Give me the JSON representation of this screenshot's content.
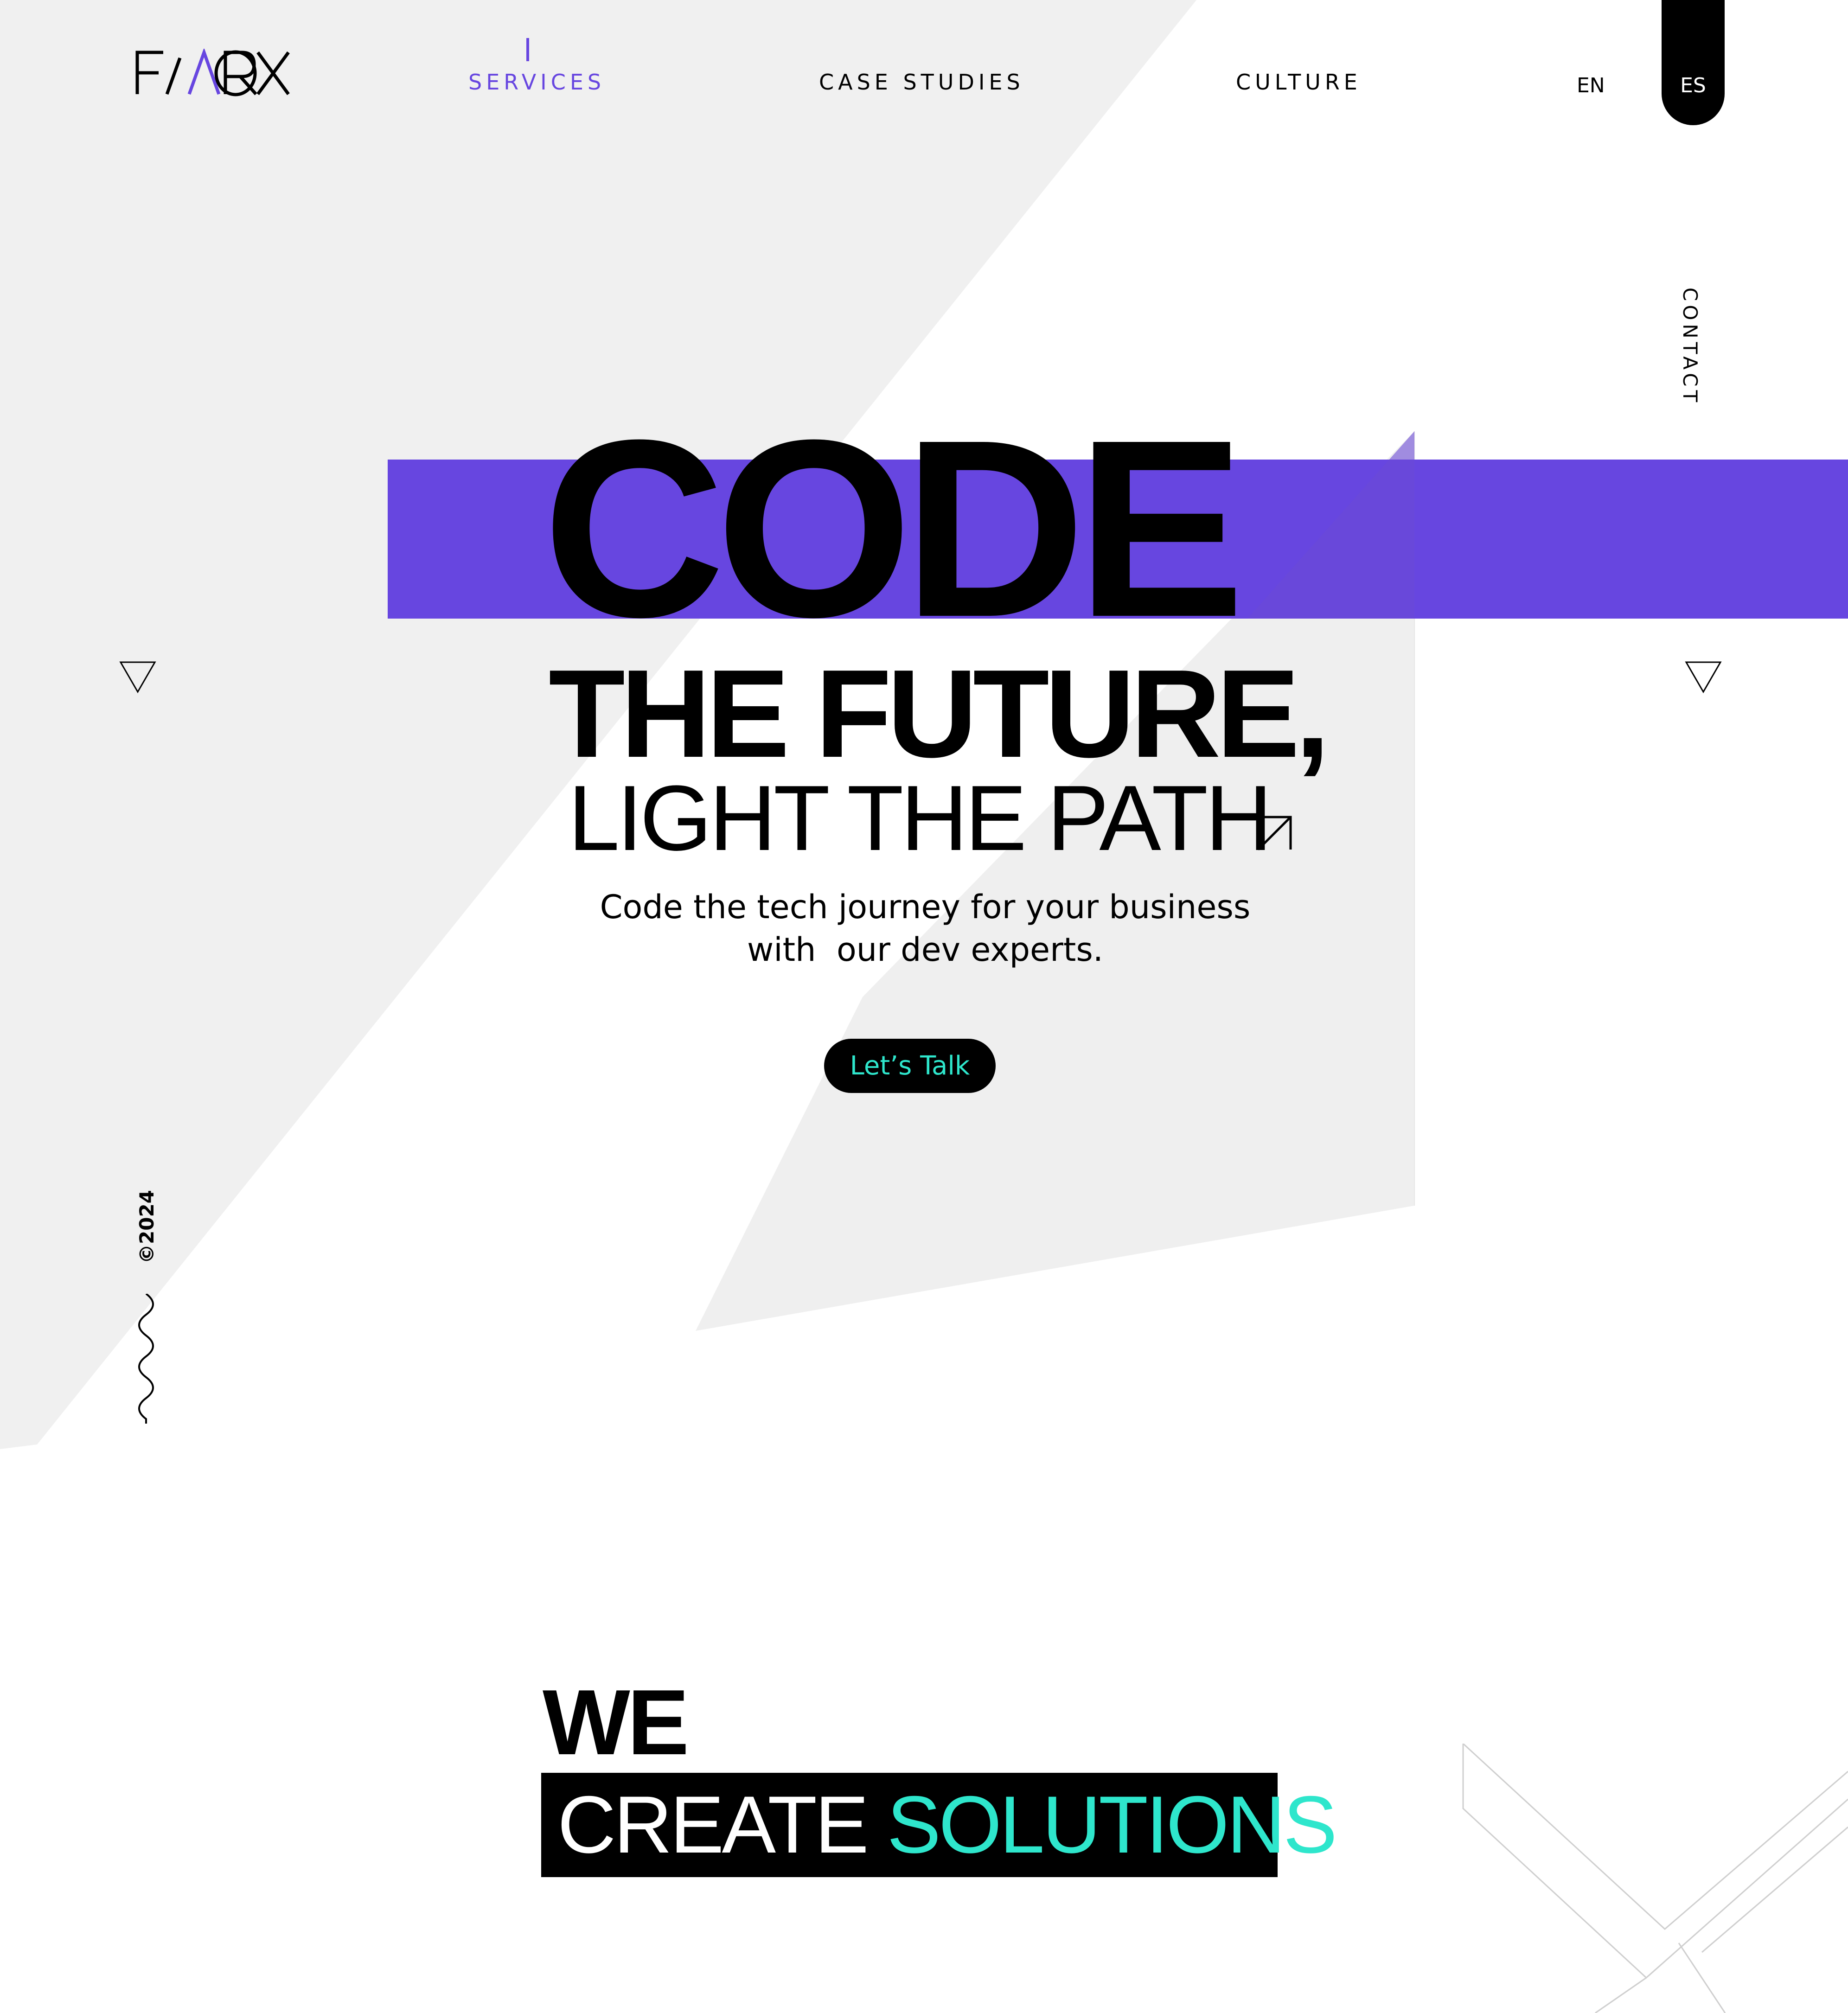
{
  "brand": {
    "logo_text": "FAROX",
    "accent_color": "#6746e0",
    "highlight_color": "#2ee6cc"
  },
  "nav": {
    "items": [
      {
        "label": "SERVICES",
        "active": true
      },
      {
        "label": "CASE STUDIES",
        "active": false
      },
      {
        "label": "CULTURE",
        "active": false
      }
    ],
    "languages": [
      {
        "code": "EN",
        "selected": false
      },
      {
        "code": "ES",
        "selected": true
      }
    ],
    "contact_label": "CONTACT"
  },
  "hero": {
    "line1": "CODE",
    "line2": "THE FUTURE,",
    "line3": "LIGHT THE PATH",
    "subtitle_line1": "Code the tech journey for your business",
    "subtitle_line2": "with  our dev experts.",
    "cta_label": "Let’s Talk",
    "arrow_icon": "arrow-up-right-icon"
  },
  "side": {
    "copyright": "©2024",
    "wave_icon": "squiggle-icon",
    "triangle_icon": "triangle-down-icon"
  },
  "section2": {
    "we": "WE",
    "create": "CREATE",
    "solutions": "SOLUTIONS"
  }
}
